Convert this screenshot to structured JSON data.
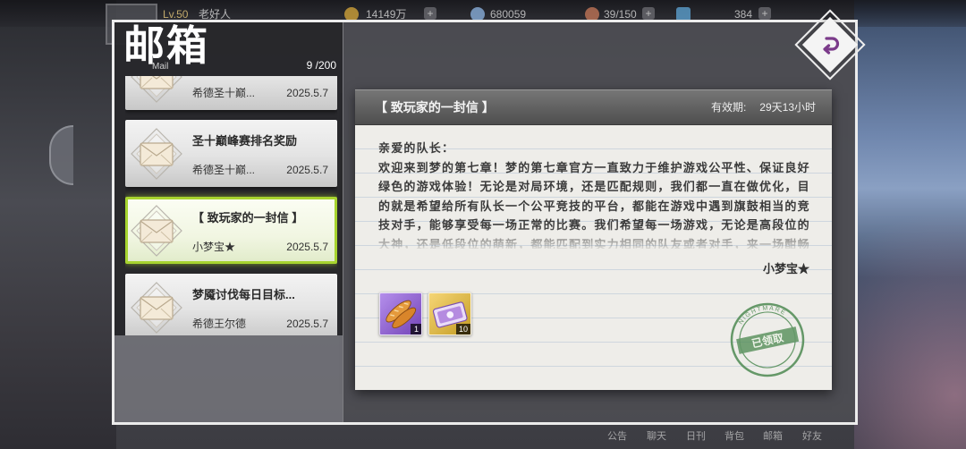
{
  "header": {
    "title": "邮箱",
    "subtitle": "Mail",
    "mail_count": "9 /200"
  },
  "topbar": {
    "level": "Lv.50",
    "nickname": "老好人",
    "coins": "14149万",
    "gems": "680059",
    "stamina": "39/150",
    "tickets": "384"
  },
  "bottombar": {
    "items": [
      "公告",
      "聊天",
      "日刊",
      "背包",
      "邮箱",
      "好友"
    ]
  },
  "mail_list": [
    {
      "title": "",
      "sender": "希德圣十巅...",
      "date": "2025.5.7",
      "selected": false
    },
    {
      "title": "圣十巅峰赛排名奖励",
      "sender": "希德圣十巅...",
      "date": "2025.5.7",
      "selected": false
    },
    {
      "title": "【 致玩家的一封信 】",
      "sender": "小梦宝★",
      "date": "2025.5.7",
      "selected": true
    },
    {
      "title": "梦魇讨伐每日目标...",
      "sender": "希德王尔德",
      "date": "2025.5.7",
      "selected": false
    }
  ],
  "letter": {
    "title": "【 致玩家的一封信 】",
    "expiry_label": "有效期:",
    "expiry_value": "29天13小时",
    "greeting": "亲爱的队长：",
    "body": "欢迎来到梦的第七章！梦的第七章官方一直致力于维护游戏公平性、保证良好绿色的游戏体验！无论是对局环境，还是匹配规则，我们都一直在做优化，目的就是希望给所有队长一个公平竞技的平台，都能在游戏中遇到旗鼓相当的竞技对手，能够享受每一场正常的比赛。我们希望每一场游戏，无论是高段位的大神，还是低段位的萌新，都能匹配到实力相同的队友或者对手，来一场酣畅",
    "signature": "小梦宝★",
    "attachments": [
      {
        "icon": "bread-icon",
        "count": "1",
        "rarity_color": "#8c52e0"
      },
      {
        "icon": "ticket-icon",
        "count": "10",
        "rarity_color": "#f0bf2c"
      }
    ],
    "stamp": {
      "ring_text": "NIGHTMARE",
      "text": "已领取"
    }
  },
  "icons": {
    "back": "return-arrow-icon",
    "mail": "envelope-icon"
  },
  "colors": {
    "accent": "#a7d42f",
    "back_icon": "#7b3b8a",
    "stamp": "#4e8a52"
  }
}
